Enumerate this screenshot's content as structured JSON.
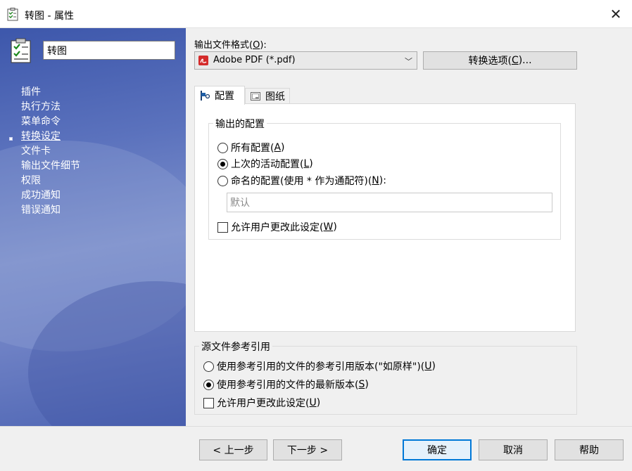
{
  "window": {
    "title": "转图 - 属性",
    "close_glyph": "✕"
  },
  "sidebar": {
    "name_value": "转图",
    "items": [
      {
        "label": "插件"
      },
      {
        "label": "执行方法"
      },
      {
        "label": "菜单命令"
      },
      {
        "label": "转换设定"
      },
      {
        "label": "文件卡"
      },
      {
        "label": "输出文件细节"
      },
      {
        "label": "权限"
      },
      {
        "label": "成功通知"
      },
      {
        "label": "错误通知"
      }
    ],
    "active_index": 3
  },
  "output_format": {
    "label": "输出文件格式(",
    "label_key": "O",
    "label_end": "):",
    "selected": "Adobe PDF (*.pdf)",
    "convert_options_label": "转换选项(",
    "convert_options_key": "C",
    "convert_options_end": ")..."
  },
  "tabs": [
    {
      "label": "配置",
      "icon": "config-flag-icon"
    },
    {
      "label": "图纸",
      "icon": "drawing-sheet-icon"
    }
  ],
  "config_group": {
    "title": "输出的配置",
    "opt_all": {
      "text": "所有配置(",
      "key": "A",
      "end": ")"
    },
    "opt_last": {
      "text": "上次的活动配置(",
      "key": "L",
      "end": ")"
    },
    "opt_named": {
      "text": "命名的配置(使用 * 作为通配符)(",
      "key": "N",
      "end": "):"
    },
    "named_value": "默认",
    "allow_change": {
      "text": "允许用户更改此设定(",
      "key": "W",
      "end": ")"
    },
    "selected": "last"
  },
  "source_ref_group": {
    "title": "源文件参考引用",
    "opt_asis": {
      "text": "使用参考引用的文件的参考引用版本(\"如原样\")(",
      "key": "U",
      "end": ")"
    },
    "opt_latest": {
      "text": "使用参考引用的文件的最新版本(",
      "key": "S",
      "end": ")"
    },
    "allow_change": {
      "text": "允许用户更改此设定(",
      "key": "U",
      "end": ")"
    },
    "selected": "latest"
  },
  "buttons": {
    "prev": "< 上一步",
    "next": "下一步 >",
    "ok": "确定",
    "cancel": "取消",
    "help": "帮助"
  }
}
